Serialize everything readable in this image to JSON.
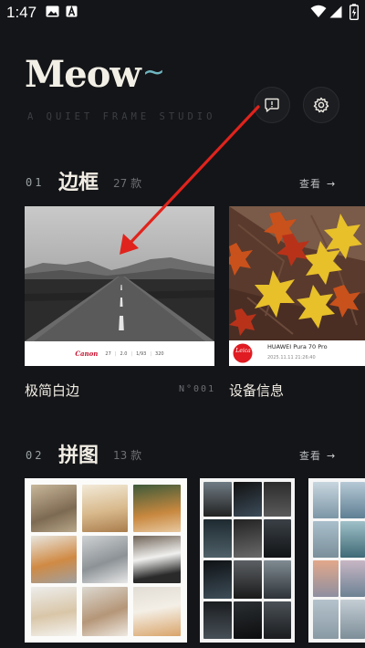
{
  "status_bar": {
    "time": "1:47"
  },
  "header": {
    "brand": "Meow",
    "brand_suffix": "~",
    "tagline": "A QUIET FRAME STUDIO"
  },
  "sections": [
    {
      "num": "01",
      "title": "边框",
      "count": "27 款",
      "view": "查看",
      "cards": [
        {
          "label": "极简白边",
          "number": "N°001",
          "exif": {
            "brand": "Canon",
            "values": [
              "27",
              "2.0",
              "1/93",
              "320"
            ]
          }
        },
        {
          "label": "设备信息",
          "exif": {
            "brand": "Leica",
            "model": "HUAWEI Pura 70 Pro",
            "datetime": "2025.11.11 21:26:40"
          }
        }
      ]
    },
    {
      "num": "02",
      "title": "拼图",
      "count": "13 款",
      "view": "查看"
    }
  ],
  "colors": {
    "background": "#141518",
    "accent": "#6fb6c1",
    "annotation_arrow": "#e0231c"
  }
}
